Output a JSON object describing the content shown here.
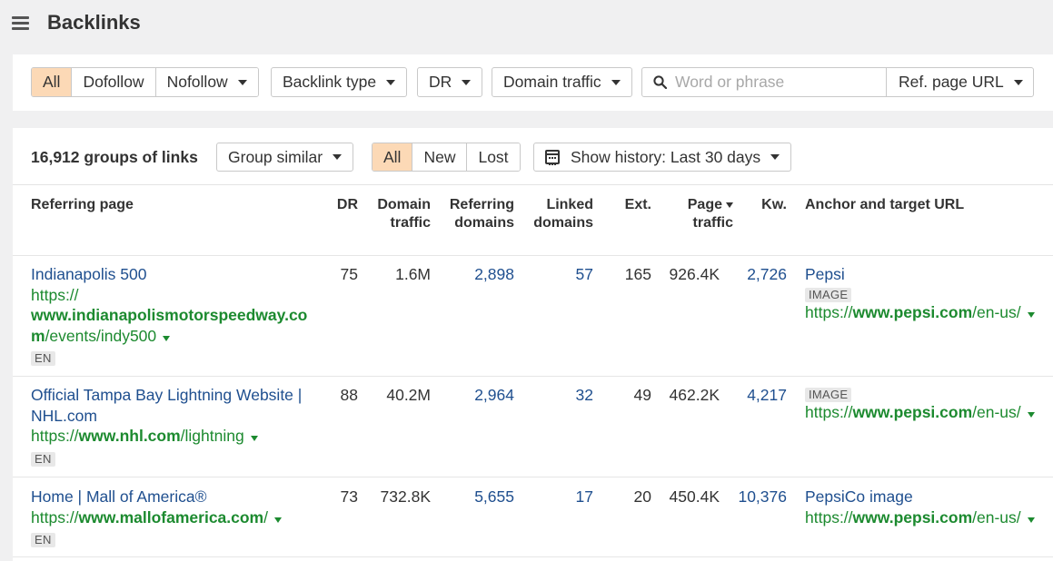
{
  "header": {
    "title": "Backlinks"
  },
  "filters": {
    "link_types": [
      "All",
      "Dofollow",
      "Nofollow"
    ],
    "backlink_type": "Backlink type",
    "dr": "DR",
    "domain_traffic": "Domain traffic",
    "search_placeholder": "Word or phrase",
    "search_scope": "Ref. page URL"
  },
  "panel": {
    "groups_label": "16,912 groups of links",
    "group_select": "Group similar",
    "status_tabs": [
      "All",
      "New",
      "Lost"
    ],
    "history": "Show history: Last 30 days"
  },
  "table": {
    "headers": {
      "referring_page": "Referring page",
      "dr": "DR",
      "domain_traffic_1": "Domain",
      "domain_traffic_2": "traffic",
      "referring_domains_1": "Referring",
      "referring_domains_2": "domains",
      "linked_domains_1": "Linked",
      "linked_domains_2": "domains",
      "ext": "Ext.",
      "page_traffic_1": "Page",
      "page_traffic_2": "traffic",
      "kw": "Kw.",
      "anchor": "Anchor and target URL"
    },
    "rows": [
      {
        "title": "Indianapolis 500",
        "url_prefix": "https://",
        "url_domain_1": "www.indianapolismotorspeedway.co",
        "url_domain_2": "m",
        "url_path": "/events/indy500",
        "lang": "EN",
        "dr": "75",
        "domain_traffic": "1.6M",
        "referring_domains": "2,898",
        "linked_domains": "57",
        "ext": "165",
        "page_traffic": "926.4K",
        "kw": "2,726",
        "anchor": "Pepsi",
        "anchor_badge": "IMAGE",
        "target_prefix": "https://",
        "target_domain": "www.pepsi.com",
        "target_path": "/en-us/"
      },
      {
        "title_1": "Official Tampa Bay Lightning Website |",
        "title_2": "NHL.com",
        "url_prefix": "https://",
        "url_domain": "www.nhl.com",
        "url_path": "/lightning",
        "lang": "EN",
        "dr": "88",
        "domain_traffic": "40.2M",
        "referring_domains": "2,964",
        "linked_domains": "32",
        "ext": "49",
        "page_traffic": "462.2K",
        "kw": "4,217",
        "anchor_badge": "IMAGE",
        "target_prefix": "https://",
        "target_domain": "www.pepsi.com",
        "target_path": "/en-us/"
      },
      {
        "title": "Home | Mall of America®",
        "url_prefix": "https://",
        "url_domain": "www.mallofamerica.com",
        "url_path": "/",
        "lang": "EN",
        "dr": "73",
        "domain_traffic": "732.8K",
        "referring_domains": "5,655",
        "linked_domains": "17",
        "ext": "20",
        "page_traffic": "450.4K",
        "kw": "10,376",
        "anchor": "PepsiCo image",
        "target_prefix": "https://",
        "target_domain": "www.pepsi.com",
        "target_path": "/en-us/"
      }
    ]
  },
  "colors": {
    "accent_active": "#fcd9b6",
    "link_blue": "#1f4f8f",
    "url_green": "#1c8a2f"
  }
}
